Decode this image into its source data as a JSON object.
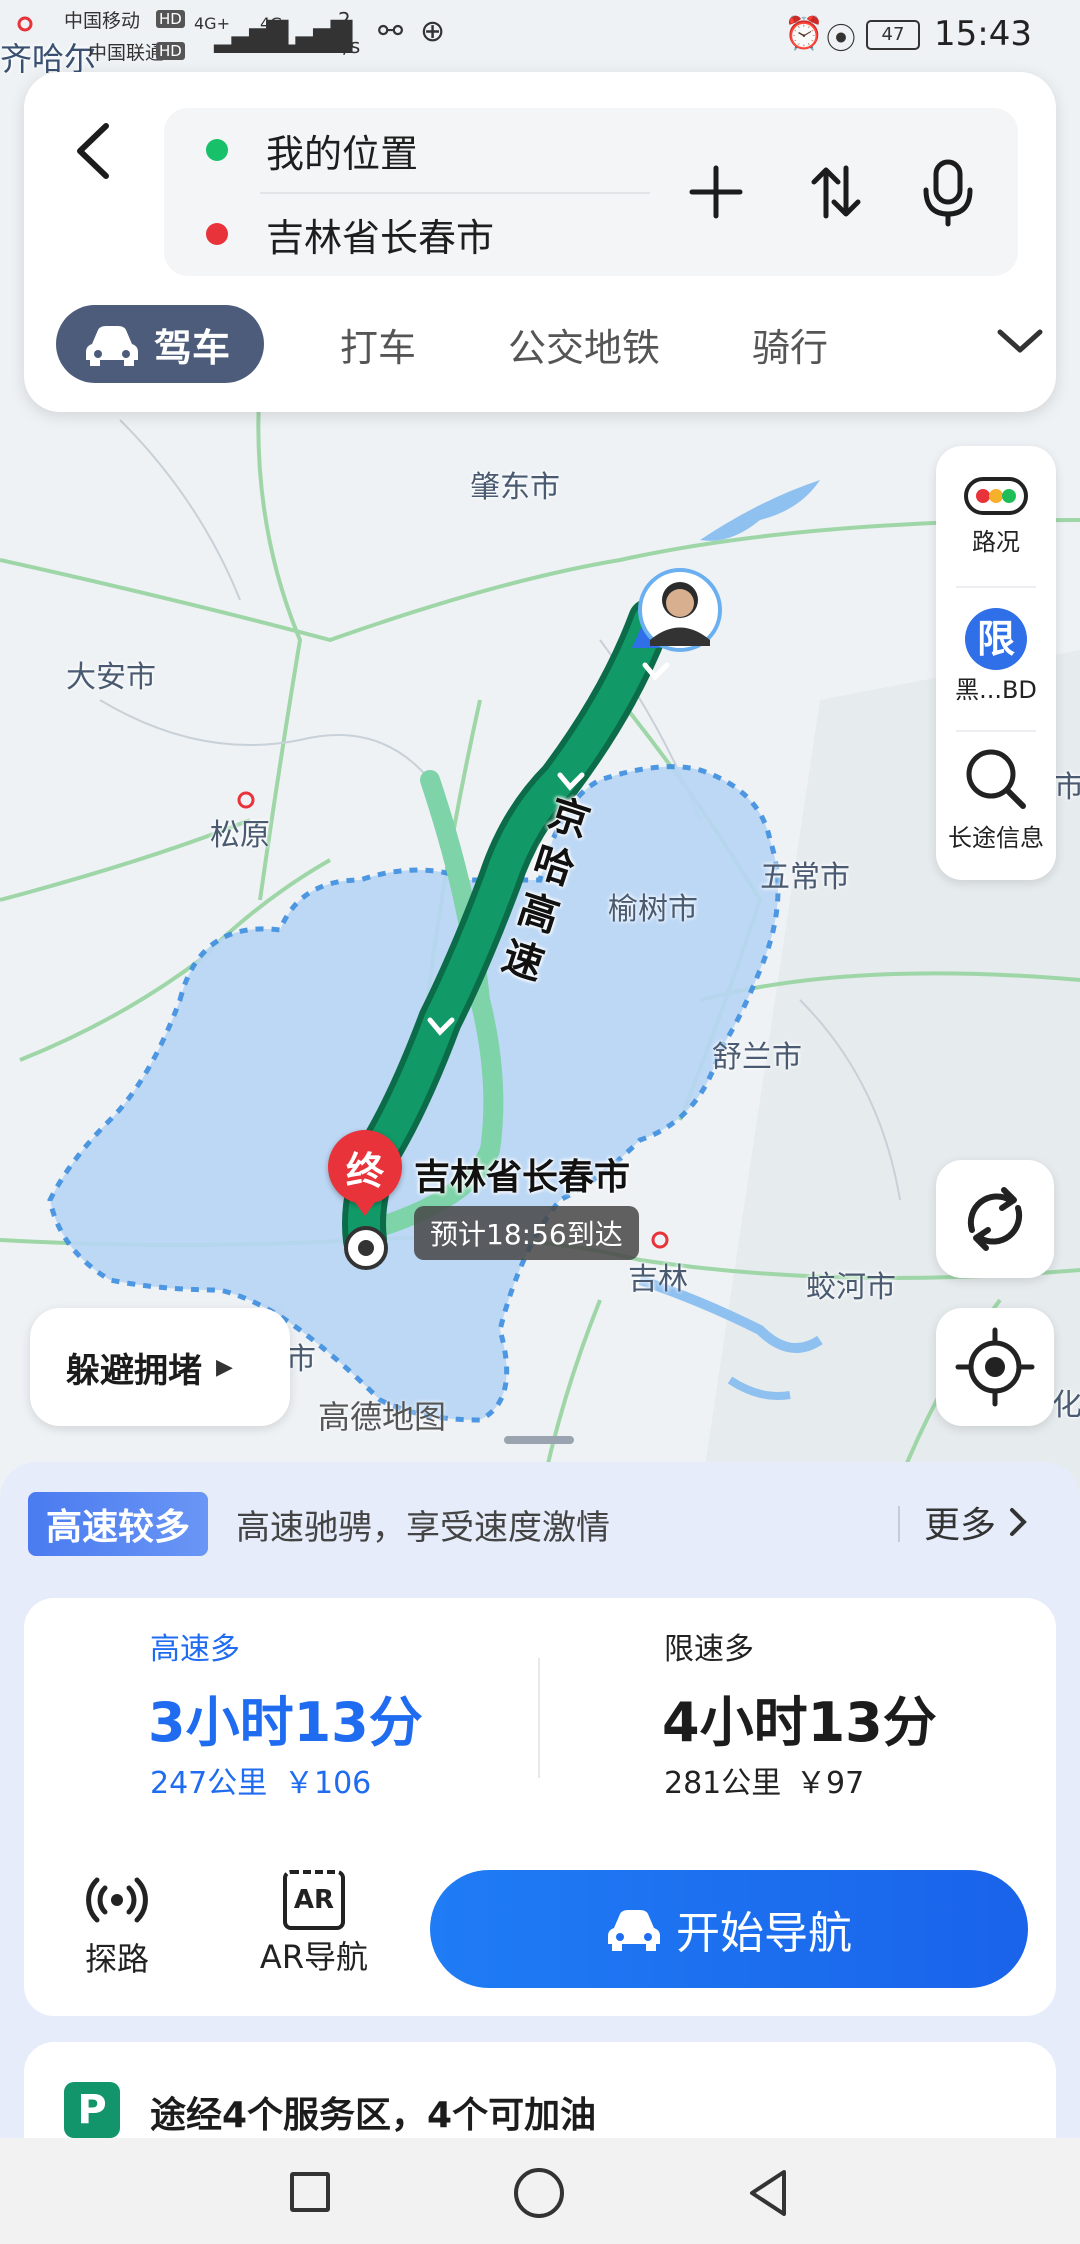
{
  "status_bar": {
    "carrier1": "中国移动",
    "carrier2": "中国联通",
    "hd": "HD",
    "net1": "4G+",
    "net2": "4G",
    "speed": "2",
    "speed_unit": "K/s",
    "battery": "47",
    "time": "15:43"
  },
  "route_inputs": {
    "origin": "我的位置",
    "destination": "吉林省长春市"
  },
  "modes": {
    "drive": "驾车",
    "taxi": "打车",
    "transit": "公交地铁",
    "bike": "骑行"
  },
  "map": {
    "labels": {
      "qiqihar": "齐哈尔",
      "zhaodong": "肇东市",
      "daan": "大安市",
      "songyuan": "松原",
      "wuchang": "五常市",
      "yushu": "榆树市",
      "shulan": "舒兰市",
      "jilin": "吉林",
      "jiaohe": "蛟河市",
      "shi": "市",
      "hua": "化",
      "shi_right": "市"
    },
    "road_name": [
      "京",
      "哈",
      "高",
      "速"
    ],
    "destination_marker": "终",
    "destination_label": "吉林省长春市",
    "eta": "预计18:56到达",
    "watermark": "高德地图"
  },
  "side_panel": {
    "traffic": "路况",
    "restrict_icon": "限",
    "restrict_label": "黑...BD",
    "longtrip": "长途信息"
  },
  "avoid_congestion": "躲避拥堵",
  "sheet": {
    "tag": "高速较多",
    "tag_desc": "高速驰骋，享受速度激情",
    "more": "更多",
    "routes": [
      {
        "name": "高速多",
        "time": "3小时13分",
        "distance": "247公里",
        "toll": "￥106",
        "selected": true
      },
      {
        "name": "限速多",
        "time": "4小时13分",
        "distance": "281公里",
        "toll": "￥97",
        "selected": false
      }
    ],
    "tanlu": "探路",
    "ar_nav": "AR导航",
    "ar_icon": "AR",
    "start_nav": "开始导航",
    "service_icon": "P",
    "service_info": "途经4个服务区，4个可加油"
  },
  "colors": {
    "route_green": "#0e8a5f",
    "accent_blue": "#1f6cf0",
    "region_blue": "#b8d6f5",
    "dest_red": "#e8333a"
  }
}
